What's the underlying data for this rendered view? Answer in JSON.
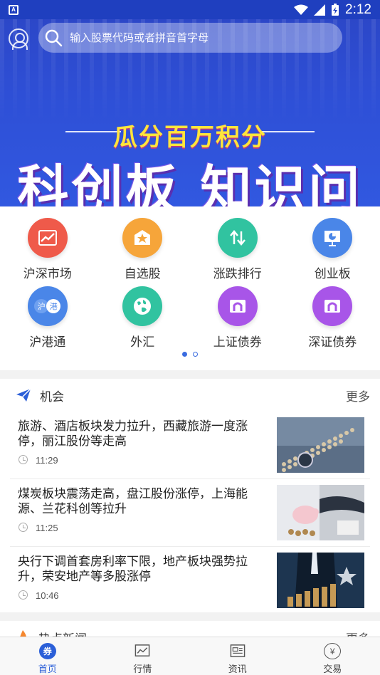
{
  "status_bar": {
    "time": "2:12",
    "app_badge": "A"
  },
  "search": {
    "placeholder": "输入股票代码或者拼音首字母"
  },
  "banner": {
    "subtitle": "瓜分百万积分",
    "title": "科创板 知识问答"
  },
  "menu": {
    "items": [
      {
        "label": "沪深市场",
        "icon": "trend-chart-icon",
        "color": "#ef5a4a"
      },
      {
        "label": "自选股",
        "icon": "star-icon",
        "color": "#f6a53a"
      },
      {
        "label": "涨跌排行",
        "icon": "up-down-arrows-icon",
        "color": "#31c3a0"
      },
      {
        "label": "创业板",
        "icon": "presentation-pie-icon",
        "color": "#4a86e8"
      },
      {
        "label": "沪港通",
        "icon": "hk-connect-icon",
        "color": "#4a86e8"
      },
      {
        "label": "外汇",
        "icon": "globe-icon",
        "color": "#31c3a0"
      },
      {
        "label": "上证债券",
        "icon": "bond-icon",
        "color": "#a855e8"
      },
      {
        "label": "深证债券",
        "icon": "bond-icon",
        "color": "#a855e8"
      }
    ],
    "hk_connect_chars": [
      "沪",
      "港"
    ]
  },
  "opportunities": {
    "title": "机会",
    "more": "更多",
    "items": [
      {
        "title": "旅游、酒店板块发力拉升，西藏旅游一度涨停，丽江股份等走高",
        "time": "11:29"
      },
      {
        "title": "煤炭板块震荡走高，盘江股份涨停，上海能源、兰花科创等拉升",
        "time": "11:25"
      },
      {
        "title": "央行下调首套房利率下限，地产板块强势拉升，荣安地产等多股涨停",
        "time": "10:46"
      }
    ]
  },
  "hot_news": {
    "title": "热点新闻",
    "more": "更多"
  },
  "nav": {
    "items": [
      {
        "label": "首页",
        "badge": "券",
        "active": true
      },
      {
        "label": "行情",
        "active": false
      },
      {
        "label": "资讯",
        "active": false
      },
      {
        "label": "交易",
        "badge": "¥",
        "active": false
      }
    ]
  },
  "colors": {
    "primary": "#2b5fd8",
    "banner": "#2e4fd6"
  }
}
